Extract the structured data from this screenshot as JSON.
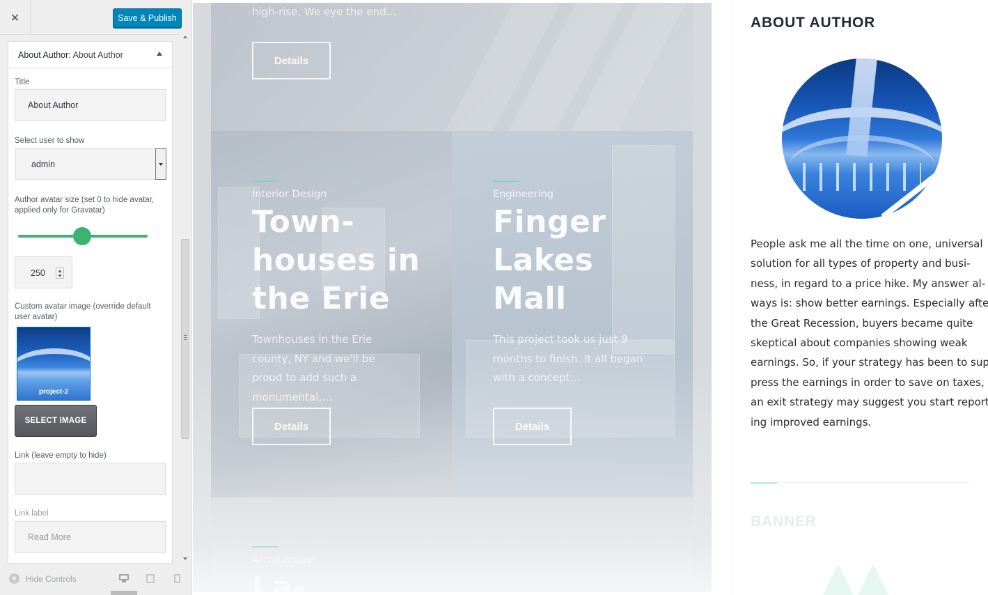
{
  "customizer": {
    "close_label": "✕",
    "save_label": "Save & Publish",
    "section": {
      "prefix": "About Author:",
      "name": "About Author"
    },
    "fields": {
      "title_label": "Title",
      "title_value": "About Author",
      "user_label": "Select user to show",
      "user_value": "admin",
      "avatar_size_label": "Author avatar size (set 0 to hide avatar, applied only for Gravatar)",
      "avatar_size_value": "250",
      "slider_level": 0.5,
      "custom_avatar_label": "Custom avatar image (override default user avatar)",
      "image_caption": "project-2",
      "select_image_label": "SELECT IMAGE",
      "link_label": "Link (leave empty to hide)",
      "link_value": "",
      "link_label_label": "Link label",
      "link_label_placeholder": "Read More"
    },
    "footer": {
      "hide_controls_label": "Hide Controls",
      "devices": [
        "desktop-icon",
        "tablet-icon",
        "mobile-icon"
      ]
    }
  },
  "preview": {
    "top_tile": {
      "description": "high-rise. We eye the end…",
      "button": "Details"
    },
    "tiles": [
      {
        "category": "Interior Design",
        "title": "Town- houses in the Erie",
        "title_lines": [
          "Town-",
          "houses in",
          "the Erie"
        ],
        "description": "Townhouses in the Erie county, NY and we'll be proud to add such a monumental,…",
        "button": "Details"
      },
      {
        "category": "Engineering",
        "title": "Finger Lakes Mall",
        "title_lines": [
          "Finger",
          "Lakes",
          "Mall"
        ],
        "description": "This project took us just 9 months to finish. It all began with a concept…",
        "button": "Details"
      },
      {
        "category": "Architecture",
        "title": "La-",
        "title_lines": [
          "La-"
        ]
      }
    ],
    "sidebar": {
      "about_title": "ABOUT AUTHOR",
      "bio_lines": [
        "People ask me all the time on one, universal",
        "solution for all types of property and busi-",
        "ness, in regard to a price hike. My answer al-",
        "ways is: show better earnings. Especially after",
        "the Great Recession, buyers became quite",
        "skeptical about companies showing weak",
        "earnings. So, if your strategy has been to sup-",
        "press the earnings in order to save on taxes,",
        "an exit strategy may suggest you start report-",
        "ing improved earnings."
      ],
      "banner_title": "BANNER"
    }
  },
  "colors": {
    "primary_button": "#0085ba",
    "slider": "#3cb371",
    "accent": "#bfece0"
  }
}
